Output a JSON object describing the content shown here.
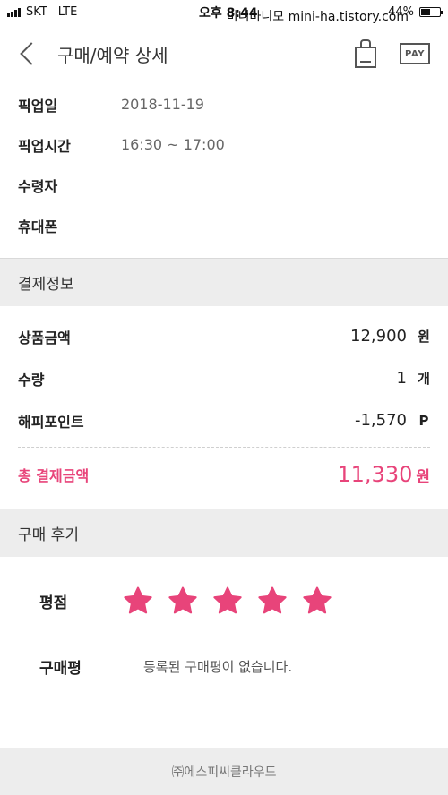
{
  "status_bar": {
    "carrier": "SKT",
    "network": "LTE",
    "time": "오후 8:44",
    "watermark": "미니마니모 mini-ha.tistory.com",
    "battery": "44%"
  },
  "header": {
    "title": "구매/예약 상세",
    "pay_label": "PAY"
  },
  "pickup": [
    {
      "label": "픽업일",
      "value": "2018-11-19"
    },
    {
      "label": "픽업시간",
      "value": "16:30 ~ 17:00"
    },
    {
      "label": "수령자",
      "value": ""
    },
    {
      "label": "휴대폰",
      "value": ""
    }
  ],
  "payment": {
    "section_title": "결제정보",
    "rows": [
      {
        "label": "상품금액",
        "amount": "12,900",
        "unit": "원"
      },
      {
        "label": "수량",
        "amount": "1",
        "unit": "개"
      },
      {
        "label": "해피포인트",
        "amount": "-1,570",
        "unit": "P"
      }
    ],
    "total": {
      "label": "총 결제금액",
      "amount": "11,330",
      "unit": "원"
    }
  },
  "review": {
    "section_title": "구매 후기",
    "rating_label": "평점",
    "rating": 5,
    "rating_max": 5,
    "comment_label": "구매평",
    "comment": "등록된 구매평이 없습니다."
  },
  "footer": {
    "company": "㈜에스피씨클라우드"
  },
  "colors": {
    "accent": "#e8447a",
    "section_bg": "#ededed"
  }
}
